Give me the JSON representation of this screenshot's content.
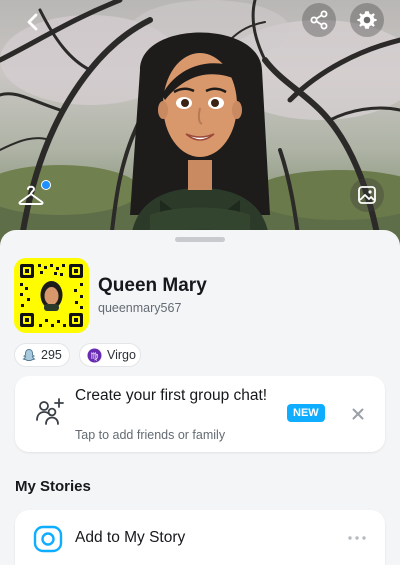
{
  "header": {
    "icons": {
      "back": "chevron-left-icon",
      "share": "share-icon",
      "settings": "gear-icon",
      "outfit": "hanger-icon",
      "photo": "photo-icon"
    }
  },
  "profile": {
    "display_name": "Queen Mary",
    "username": "queenmary567",
    "snapscore": "295",
    "zodiac": "Virgo"
  },
  "group_chat_card": {
    "title": "Create your first group chat!",
    "subtitle": "Tap to add friends or family",
    "badge": "NEW"
  },
  "stories": {
    "section_title": "My Stories",
    "add_label": "Add to My Story"
  },
  "colors": {
    "snap_yellow": "#FFFC00",
    "accent_blue": "#0FADFF",
    "zodiac_purple": "#6A2BB3"
  }
}
